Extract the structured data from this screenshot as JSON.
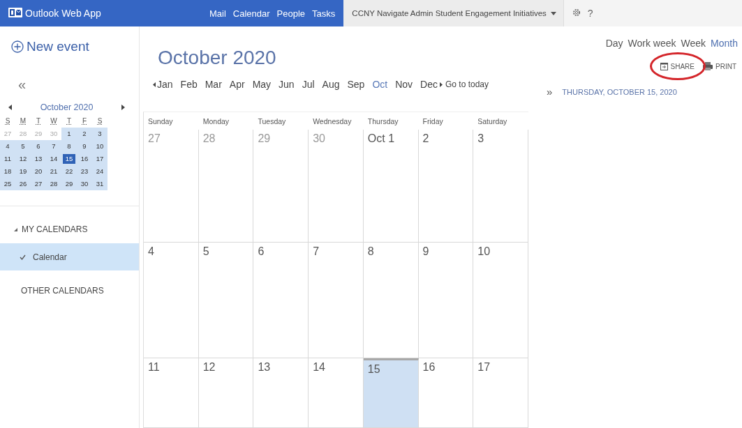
{
  "top_bar": {
    "app_name": "Outlook Web App",
    "nav": [
      "Mail",
      "Calendar",
      "People",
      "Tasks"
    ],
    "account": "CCNY Navigate Admin Student Engagement Initiatives",
    "help": "?"
  },
  "sidebar": {
    "new_event": "New event",
    "collapse": "«",
    "mini_calendar": {
      "title": "October 2020",
      "weekdays": [
        "S",
        "M",
        "T",
        "W",
        "T",
        "F",
        "S"
      ],
      "days": [
        {
          "label": "27",
          "muted": true,
          "selected": false
        },
        {
          "label": "28",
          "muted": true,
          "selected": false
        },
        {
          "label": "29",
          "muted": true,
          "selected": false
        },
        {
          "label": "30",
          "muted": true,
          "selected": false
        },
        {
          "label": "1",
          "muted": false,
          "selected": false
        },
        {
          "label": "2",
          "muted": false,
          "selected": false
        },
        {
          "label": "3",
          "muted": false,
          "selected": false
        },
        {
          "label": "4",
          "muted": false,
          "selected": false
        },
        {
          "label": "5",
          "muted": false,
          "selected": false
        },
        {
          "label": "6",
          "muted": false,
          "selected": false
        },
        {
          "label": "7",
          "muted": false,
          "selected": false
        },
        {
          "label": "8",
          "muted": false,
          "selected": false
        },
        {
          "label": "9",
          "muted": false,
          "selected": false
        },
        {
          "label": "10",
          "muted": false,
          "selected": false
        },
        {
          "label": "11",
          "muted": false,
          "selected": false
        },
        {
          "label": "12",
          "muted": false,
          "selected": false
        },
        {
          "label": "13",
          "muted": false,
          "selected": false
        },
        {
          "label": "14",
          "muted": false,
          "selected": false
        },
        {
          "label": "15",
          "muted": false,
          "selected": true
        },
        {
          "label": "16",
          "muted": false,
          "selected": false
        },
        {
          "label": "17",
          "muted": false,
          "selected": false
        },
        {
          "label": "18",
          "muted": false,
          "selected": false
        },
        {
          "label": "19",
          "muted": false,
          "selected": false
        },
        {
          "label": "20",
          "muted": false,
          "selected": false
        },
        {
          "label": "21",
          "muted": false,
          "selected": false
        },
        {
          "label": "22",
          "muted": false,
          "selected": false
        },
        {
          "label": "23",
          "muted": false,
          "selected": false
        },
        {
          "label": "24",
          "muted": false,
          "selected": false
        },
        {
          "label": "25",
          "muted": false,
          "selected": false
        },
        {
          "label": "26",
          "muted": false,
          "selected": false
        },
        {
          "label": "27",
          "muted": false,
          "selected": false
        },
        {
          "label": "28",
          "muted": false,
          "selected": false
        },
        {
          "label": "29",
          "muted": false,
          "selected": false
        },
        {
          "label": "30",
          "muted": false,
          "selected": false
        },
        {
          "label": "31",
          "muted": false,
          "selected": false
        }
      ]
    },
    "groups": [
      {
        "label": "MY CALENDARS",
        "expanded": true,
        "items": [
          {
            "label": "Calendar",
            "checked": true,
            "selected": true
          }
        ]
      },
      {
        "label": "OTHER CALENDARS",
        "expanded": false
      }
    ]
  },
  "main": {
    "title": "October 2020",
    "months": [
      {
        "label": "Jan",
        "selected": false
      },
      {
        "label": "Feb",
        "selected": false
      },
      {
        "label": "Mar",
        "selected": false
      },
      {
        "label": "Apr",
        "selected": false
      },
      {
        "label": "May",
        "selected": false
      },
      {
        "label": "Jun",
        "selected": false
      },
      {
        "label": "Jul",
        "selected": false
      },
      {
        "label": "Aug",
        "selected": false
      },
      {
        "label": "Sep",
        "selected": false
      },
      {
        "label": "Oct",
        "selected": true
      },
      {
        "label": "Nov",
        "selected": false
      },
      {
        "label": "Dec",
        "selected": false
      }
    ],
    "go_to_today": "Go to today",
    "weekdays": [
      "Sunday",
      "Monday",
      "Tuesday",
      "Wednesday",
      "Thursday",
      "Friday",
      "Saturday"
    ],
    "days": [
      {
        "label": "27",
        "muted": true,
        "selected": false
      },
      {
        "label": "28",
        "muted": true,
        "selected": false
      },
      {
        "label": "29",
        "muted": true,
        "selected": false
      },
      {
        "label": "30",
        "muted": true,
        "selected": false
      },
      {
        "label": "Oct 1",
        "muted": false,
        "selected": false
      },
      {
        "label": "2",
        "muted": false,
        "selected": false
      },
      {
        "label": "3",
        "muted": false,
        "selected": false
      },
      {
        "label": "4",
        "muted": false,
        "selected": false
      },
      {
        "label": "5",
        "muted": false,
        "selected": false
      },
      {
        "label": "6",
        "muted": false,
        "selected": false
      },
      {
        "label": "7",
        "muted": false,
        "selected": false
      },
      {
        "label": "8",
        "muted": false,
        "selected": false
      },
      {
        "label": "9",
        "muted": false,
        "selected": false
      },
      {
        "label": "10",
        "muted": false,
        "selected": false
      },
      {
        "label": "11",
        "muted": false,
        "selected": false
      },
      {
        "label": "12",
        "muted": false,
        "selected": false
      },
      {
        "label": "13",
        "muted": false,
        "selected": false
      },
      {
        "label": "14",
        "muted": false,
        "selected": false
      },
      {
        "label": "15",
        "muted": false,
        "selected": true
      },
      {
        "label": "16",
        "muted": false,
        "selected": false
      },
      {
        "label": "17",
        "muted": false,
        "selected": false
      }
    ]
  },
  "right_pane": {
    "views": [
      {
        "label": "Day",
        "selected": false
      },
      {
        "label": "Work week",
        "selected": false
      },
      {
        "label": "Week",
        "selected": false
      },
      {
        "label": "Month",
        "selected": true
      }
    ],
    "actions": [
      {
        "label": "SHARE",
        "kind": "share",
        "circled": true
      },
      {
        "label": "PRINT",
        "kind": "print",
        "circled": false
      }
    ],
    "expand": "»",
    "day_heading": "THURSDAY, OCTOBER 15, 2020"
  }
}
